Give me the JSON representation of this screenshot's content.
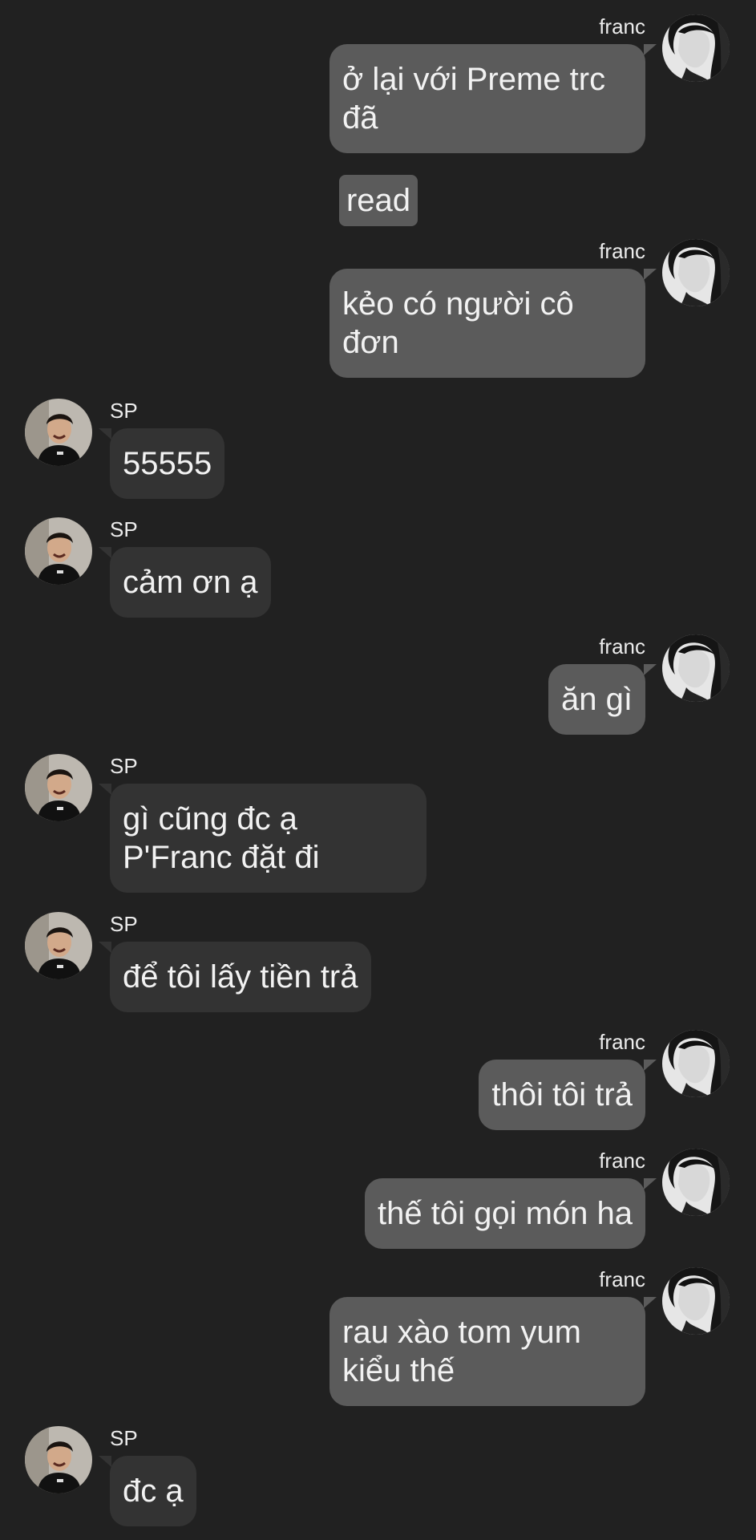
{
  "colors": {
    "background": "#212121",
    "sent_bubble": "#5b5b5b",
    "received_bubble": "#333333",
    "text": "#f2f2f2"
  },
  "users": {
    "franc": "franc",
    "sp": "SP"
  },
  "read_label": "read",
  "messages": [
    {
      "sender": "franc",
      "side": "right",
      "text": "ở lại với Preme trc\nđã"
    },
    {
      "sender": "franc",
      "side": "right",
      "text": "kẻo có người cô\nđơn"
    },
    {
      "sender": "SP",
      "side": "left",
      "text": "55555"
    },
    {
      "sender": "SP",
      "side": "left",
      "text": "cảm ơn ạ"
    },
    {
      "sender": "franc",
      "side": "right",
      "text": "ăn gì"
    },
    {
      "sender": "SP",
      "side": "left",
      "text": "gì cũng đc ạ\nP'Franc đặt đi"
    },
    {
      "sender": "SP",
      "side": "left",
      "text": "để tôi lấy tiền trả"
    },
    {
      "sender": "franc",
      "side": "right",
      "text": "thôi tôi trả"
    },
    {
      "sender": "franc",
      "side": "right",
      "text": "thế tôi gọi món ha"
    },
    {
      "sender": "franc",
      "side": "right",
      "text": "rau xào tom yum\nkiểu thế"
    },
    {
      "sender": "SP",
      "side": "left",
      "text": "đc ạ"
    }
  ]
}
